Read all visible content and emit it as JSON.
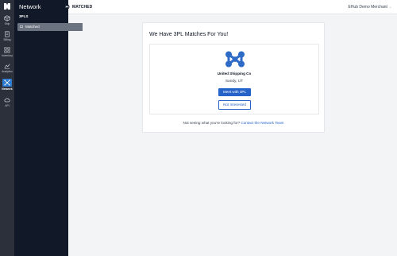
{
  "colors": {
    "rail": "#2b303a",
    "sidebar": "#111827",
    "accent": "#2563c9",
    "background": "#f3f4f6"
  },
  "rail": {
    "items": [
      {
        "label": "Ship",
        "icon": "box-icon"
      },
      {
        "label": "Billing",
        "icon": "invoice-icon"
      },
      {
        "label": "Inventory",
        "icon": "inventory-icon"
      },
      {
        "label": "Analytics",
        "icon": "chart-icon"
      },
      {
        "label": "Network",
        "icon": "network-icon",
        "active": true
      },
      {
        "label": "API",
        "icon": "cloud-icon"
      }
    ]
  },
  "sidebar": {
    "title": "Network",
    "section": "3PLS",
    "items": [
      {
        "label": "Matched",
        "icon": "match-icon",
        "active": true
      }
    ]
  },
  "header": {
    "title": "MATCHED",
    "user": "EHub Demo Merchant"
  },
  "main": {
    "heading": "We Have 3PL Matches For You!",
    "partner": {
      "name": "United Shipping Co",
      "location": "Sandy, UT"
    },
    "meet_label": "Meet with 3PL",
    "not_interested_label": "Not Interested",
    "footer_text": "Not seeing what you're looking for?",
    "footer_link": "Contact the Network Team"
  }
}
